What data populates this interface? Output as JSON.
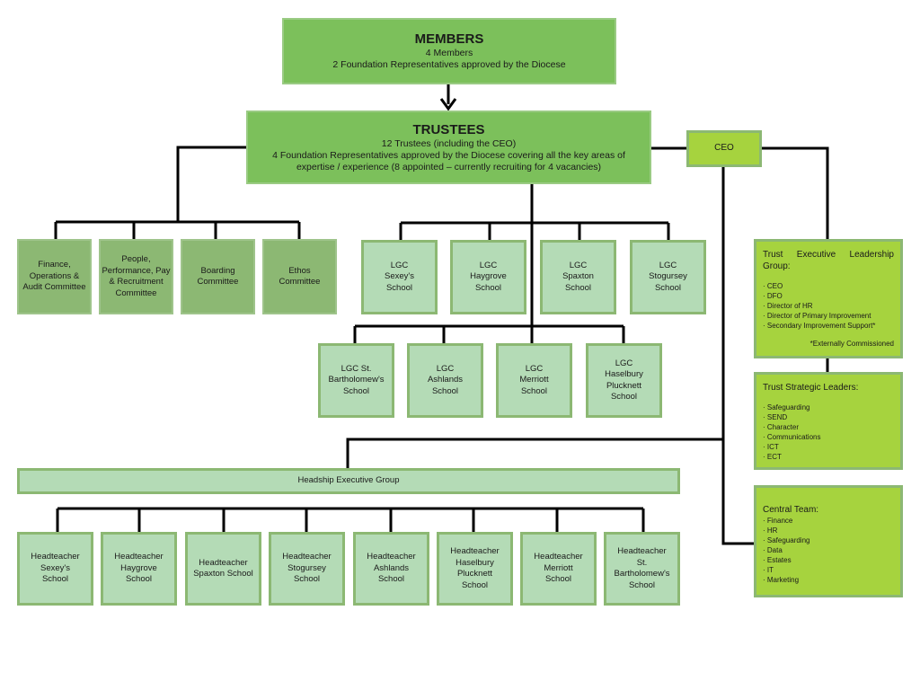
{
  "members": {
    "title": "MEMBERS",
    "lines": [
      "4 Members",
      "2 Foundation Representatives approved by the Diocese"
    ]
  },
  "trustees": {
    "title": "TRUSTEES",
    "lines": [
      "12 Trustees (including the CEO)",
      "4 Foundation Representatives approved by the Diocese covering all the key areas of expertise / experience  (8 appointed – currently recruiting for 4 vacancies)"
    ]
  },
  "ceo": "CEO",
  "committees": [
    "Finance, Operations & Audit Committee",
    "People, Performance, Pay & Recruitment Committee",
    "Boarding Committee",
    "Ethos Committee"
  ],
  "lgc_row1": [
    "LGC Sexey's School",
    "LGC Haygrove School",
    "LGC Spaxton School",
    "LGC Stogursey School"
  ],
  "lgc_row2": [
    "LGC St. Bartholomew's School",
    "LGC Ashlands School",
    "LGC Merriott School",
    "LGC Haselbury Plucknett School"
  ],
  "headship": "Headship Executive Group",
  "headteachers": [
    "Headteacher Sexey's School",
    "Headteacher Haygrove School",
    "Headteacher Spaxton School",
    "Headteacher Stogursey School",
    "Headteacher Ashlands School",
    "Headteacher Haselbury Plucknett School",
    "Headteacher Merriott School",
    "Headteacher St. Bartholomew's School"
  ],
  "executive": {
    "title": "Trust Executive Leadership Group:",
    "items": [
      "CEO",
      "DFO",
      "Director of HR",
      "Director of Primary Improvement",
      "Secondary Improvement Support*"
    ],
    "note": "*Externally Commissioned"
  },
  "strategic": {
    "title": "Trust Strategic Leaders:",
    "items": [
      "Safeguarding",
      "SEND",
      "Character",
      "Communications",
      "ICT",
      "ECT"
    ]
  },
  "central": {
    "title": "Central Team:",
    "items": [
      "Finance",
      "HR",
      "Safeguarding",
      "Data",
      "Estates",
      "IT",
      "Marketing"
    ]
  },
  "colors": {
    "top": "#7cc05b",
    "committee": "#8cb873",
    "lgc": "#b4dbb6",
    "right": "#a6d33e",
    "border": "#8cb873"
  }
}
